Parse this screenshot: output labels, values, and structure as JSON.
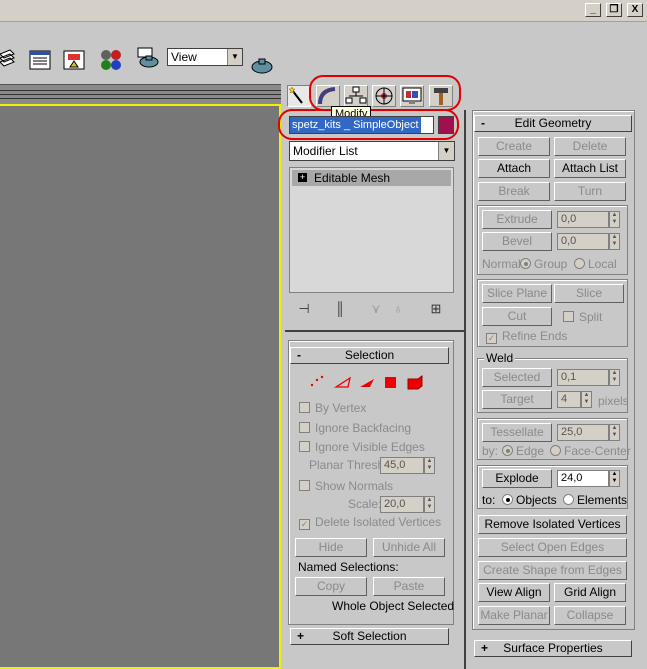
{
  "window": {
    "minimize": "_",
    "restore": "❐",
    "close": "X"
  },
  "toolbar": {
    "view_select": "View"
  },
  "tooltip": "Modify",
  "object": {
    "name": "spetz_kits _ SimpleObject",
    "color": "#a0104c"
  },
  "modifier_list": "Modifier List",
  "stack": {
    "items": [
      {
        "label": "Editable Mesh",
        "expand": "+"
      }
    ]
  },
  "selection": {
    "title": "Selection",
    "collapse": "-",
    "by_vertex": "By Vertex",
    "ignore_backfacing": "Ignore Backfacing",
    "ignore_visible_edges": "Ignore Visible Edges",
    "planar_thresh_label": "Planar Thresh:",
    "planar_thresh_value": "45,0",
    "show_normals": "Show Normals",
    "scale_label": "Scale:",
    "scale_value": "20,0",
    "delete_isolated": "Delete Isolated Vertices",
    "hide": "Hide",
    "unhide_all": "Unhide All",
    "named_selections": "Named Selections:",
    "copy": "Copy",
    "paste": "Paste",
    "status": "Whole Object Selected"
  },
  "soft_selection": {
    "title": "Soft Selection",
    "expand": "+"
  },
  "edit_geometry": {
    "title": "Edit Geometry",
    "collapse": "-",
    "create": "Create",
    "delete": "Delete",
    "attach": "Attach",
    "attach_list": "Attach List",
    "break": "Break",
    "turn": "Turn",
    "extrude": "Extrude",
    "extrude_value": "0,0",
    "bevel": "Bevel",
    "bevel_value": "0,0",
    "normal_label": "Normal:",
    "group": "Group",
    "local": "Local",
    "slice_plane": "Slice Plane",
    "slice": "Slice",
    "cut": "Cut",
    "split": "Split",
    "refine_ends": "Refine Ends",
    "weld_label": "Weld",
    "selected": "Selected",
    "selected_value": "0,1",
    "target": "Target",
    "target_value": "4",
    "pixels": "pixels",
    "tessellate": "Tessellate",
    "tessellate_value": "25,0",
    "by_label": "by:",
    "edge": "Edge",
    "face_center": "Face-Center",
    "explode": "Explode",
    "explode_value": "24,0",
    "to_label": "to:",
    "objects": "Objects",
    "elements": "Elements",
    "remove_isolated": "Remove Isolated Vertices",
    "select_open_edges": "Select Open Edges",
    "create_shape": "Create Shape from Edges",
    "view_align": "View Align",
    "grid_align": "Grid Align",
    "make_planar": "Make Planar",
    "collapse_btn": "Collapse"
  },
  "surface_properties": {
    "title": "Surface Properties",
    "expand": "+"
  }
}
